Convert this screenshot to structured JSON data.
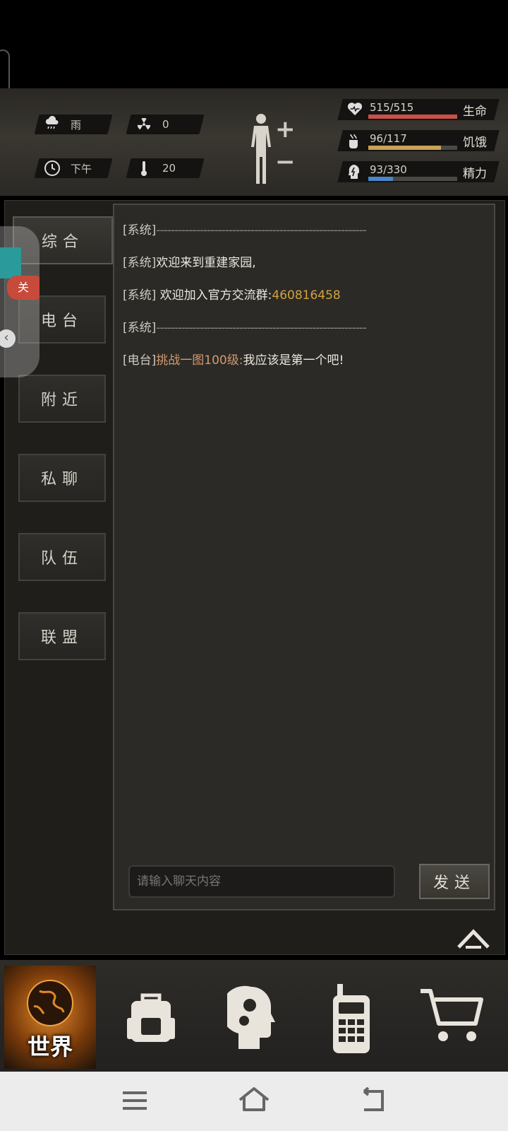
{
  "hud": {
    "weather": "雨",
    "radiation": "0",
    "time_of_day": "下午",
    "temperature": "20",
    "stats": [
      {
        "value": "515/515",
        "label": "生命",
        "fill": 1.0,
        "color": "#c8524a",
        "icon": "heart-pulse-icon"
      },
      {
        "value": "96/117",
        "label": "饥饿",
        "fill": 0.82,
        "color": "#c9a255",
        "icon": "food-icon"
      },
      {
        "value": "93/330",
        "label": "精力",
        "fill": 0.28,
        "color": "#4a86c8",
        "icon": "energy-head-icon"
      }
    ]
  },
  "tabs": [
    {
      "label": "综合",
      "active": true
    },
    {
      "label": "电台",
      "active": false
    },
    {
      "label": "附近",
      "active": false
    },
    {
      "label": "私聊",
      "active": false
    },
    {
      "label": "队伍",
      "active": false
    },
    {
      "label": "联盟",
      "active": false
    }
  ],
  "messages": [
    {
      "tag": "[系统]",
      "parts": [
        {
          "text": "----------------------------------------------------------",
          "style": "dash"
        }
      ]
    },
    {
      "tag": "[系统]",
      "parts": [
        {
          "text": "欢迎来到重建家园,",
          "style": "white"
        }
      ]
    },
    {
      "tag": "[系统]",
      "parts": [
        {
          "text": " 欢迎加入官方交流群:",
          "style": "white"
        },
        {
          "text": "460816458",
          "style": "gold"
        }
      ]
    },
    {
      "tag": "[系统]",
      "parts": [
        {
          "text": "----------------------------------------------------------",
          "style": "dash"
        }
      ]
    },
    {
      "tag": "[电台]",
      "parts": [
        {
          "text": "挑战一图100级:",
          "style": "orange"
        },
        {
          "text": "我应该是第一个吧!",
          "style": "white"
        }
      ]
    }
  ],
  "chat_input": {
    "placeholder": "请输入聊天内容"
  },
  "send_label": "发送",
  "bottom_nav": {
    "world_label": "世界"
  },
  "float_badge": "关"
}
